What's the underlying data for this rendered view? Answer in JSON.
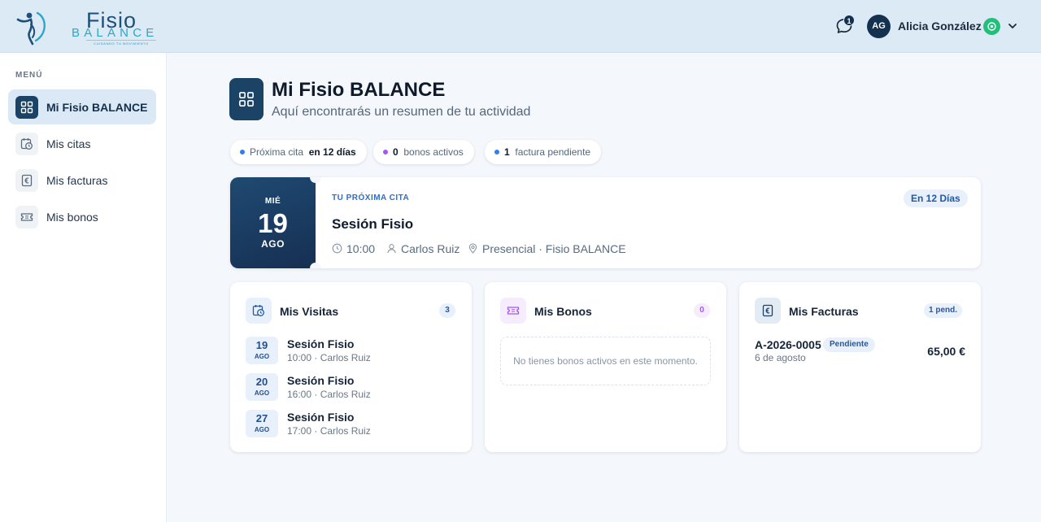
{
  "brand": {
    "name_line1": "Fisio",
    "name_line2": "BALANCE",
    "tagline": "CUIDANDO TU MOVIMIENTO"
  },
  "header": {
    "notification_count": "1",
    "user_initials": "AG",
    "user_name": "Alicia González"
  },
  "sidebar": {
    "menu_label": "MENÚ",
    "items": [
      {
        "label": "Mi Fisio BALANCE",
        "active": true
      },
      {
        "label": "Mis citas"
      },
      {
        "label": "Mis facturas"
      },
      {
        "label": "Mis bonos"
      }
    ]
  },
  "page": {
    "title": "Mi Fisio BALANCE",
    "subtitle": "Aquí encontrarás un resumen de tu actividad"
  },
  "chips": [
    {
      "label": "Próxima cita",
      "value": "en 12 días",
      "dot_color": "#2f80ed"
    },
    {
      "value": "0",
      "label": "bonos activos",
      "dot_color": "#a855f7"
    },
    {
      "value": "1",
      "label": "factura pendiente",
      "dot_color": "#2f80ed"
    }
  ],
  "next_appointment": {
    "day_of_week": "MIÉ",
    "day": "19",
    "month": "AGO",
    "label": "TU PRÓXIMA CITA",
    "title": "Sesión Fisio",
    "time": "10:00",
    "therapist": "Carlos Ruiz",
    "location": "Presencial · Fisio BALANCE",
    "countdown": "En 12 Días"
  },
  "visits_card": {
    "title": "Mis Visitas",
    "count": "3",
    "items": [
      {
        "day": "19",
        "month": "AGO",
        "title": "Sesión Fisio",
        "detail": "10:00 · Carlos Ruiz"
      },
      {
        "day": "20",
        "month": "AGO",
        "title": "Sesión Fisio",
        "detail": "16:00 · Carlos Ruiz"
      },
      {
        "day": "27",
        "month": "AGO",
        "title": "Sesión Fisio",
        "detail": "17:00 · Carlos Ruiz"
      }
    ]
  },
  "bonos_card": {
    "title": "Mis Bonos",
    "count": "0",
    "empty_message": "No tienes bonos activos en este momento."
  },
  "invoices_card": {
    "title": "Mis Facturas",
    "badge": "1 pend.",
    "items": [
      {
        "id": "A-2026-0005",
        "status": "Pendiente",
        "date": "6 de agosto",
        "amount": "65,00 €"
      }
    ]
  },
  "colors": {
    "primary": "#1b4366",
    "accent": "#2f80ed",
    "bonos_accent": "#a855f7",
    "status_online": "#20c07a"
  }
}
